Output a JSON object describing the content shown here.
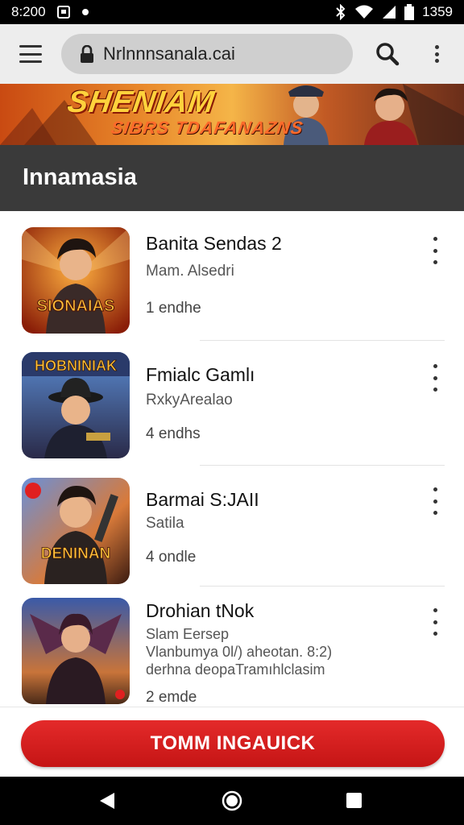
{
  "status_bar": {
    "time": "8:200",
    "battery_text": "1359"
  },
  "browser": {
    "url": "Nrlnnnsanala.cai",
    "icons": {
      "menu": "hamburger-icon",
      "lock": "lock-icon",
      "search": "search-icon",
      "more": "more-vert-icon"
    }
  },
  "banner": {
    "title": "SHENIAM",
    "subtitle": "SIBRS TDAFANAZNS",
    "colors": {
      "title": "#ffd23c",
      "subtitle": "#ff6a2a"
    }
  },
  "section": {
    "title": "Innamasia"
  },
  "items": [
    {
      "title": "Banita Sendas 2",
      "subtitle": "Mam. Alsedri",
      "subtitle2": "",
      "count": "1 endhe",
      "thumb_text": "SIONAIAS"
    },
    {
      "title": "Fmialc Gamlı",
      "subtitle": "RxkyArealao",
      "subtitle2": "",
      "count": "4 endhs",
      "thumb_text": "HOBNINIAK"
    },
    {
      "title": "Barmai S:JAII",
      "subtitle": "Satila",
      "subtitle2": "",
      "count": "4 ondle",
      "thumb_text": "DENINAN"
    },
    {
      "title": "Drohian tNok",
      "subtitle": "Slam Eersep",
      "subtitle2": "Vlanbumya 0l/) aheotan. 8:2)",
      "subtitle3": "derhna deopaTramıhlclasim",
      "count": "2 emde",
      "thumb_text": ""
    }
  ],
  "cta": {
    "label": "TOMM INGAUICK",
    "color": "#d41e1e"
  },
  "nav": {
    "icons": {
      "back": "back-triangle-icon",
      "home": "home-circle-icon",
      "recents": "recents-square-icon"
    }
  }
}
